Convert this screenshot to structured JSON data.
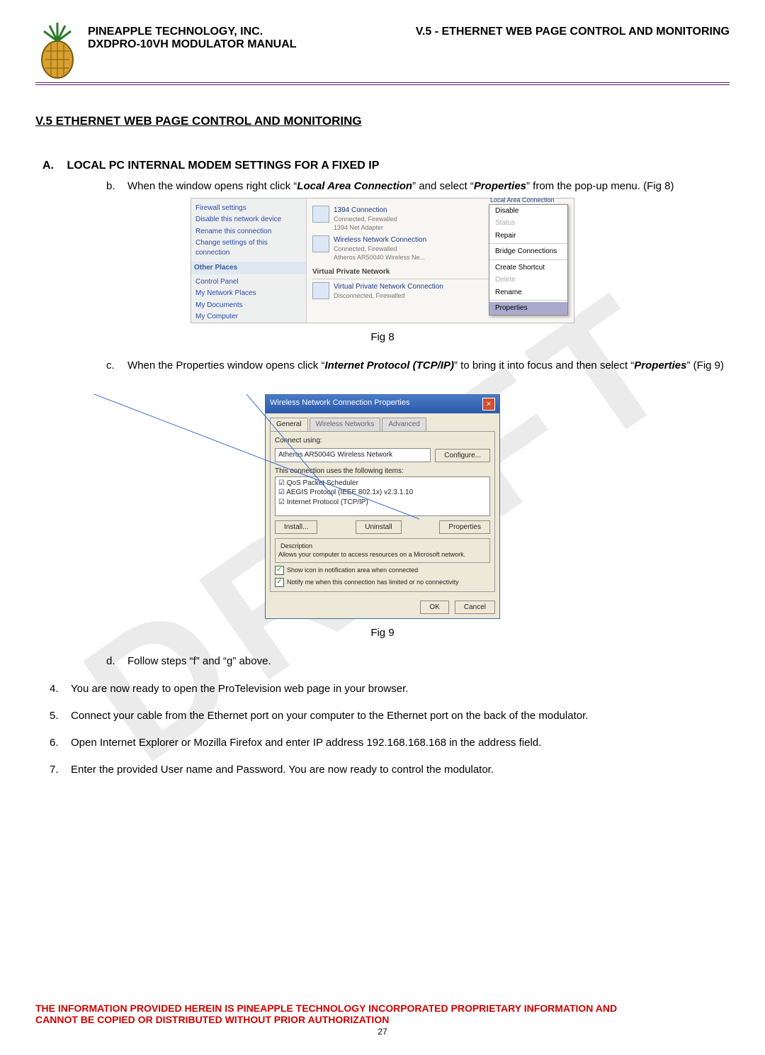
{
  "header": {
    "company": "PINEAPPLE TECHNOLOGY, INC.",
    "manual": "DXDPRO-10VH MODULATOR MANUAL",
    "section_ref": "V.5 - ETHERNET WEB PAGE CONTROL AND MONITORING"
  },
  "watermark": "DRAFT",
  "section_title": "V.5 ETHERNET WEB PAGE CONTROL AND MONITORING",
  "sub_a": {
    "letter": "A.",
    "title": "LOCAL PC INTERNAL MODEM SETTINGS FOR A FIXED IP"
  },
  "item_b": {
    "marker": "b.",
    "pre": "When the window opens right click “",
    "em1": "Local Area Connection",
    "mid": "” and select “",
    "em2": "Properties",
    "post": "” from the pop-up menu. (Fig 8)"
  },
  "fig8": {
    "caption": "Fig 8",
    "tasks": [
      "Firewall settings",
      "Disable this network device",
      "Rename this connection",
      "Change settings of this connection"
    ],
    "other_header": "Other Places",
    "other": [
      "Control Panel",
      "My Network Places",
      "My Documents",
      "My Computer"
    ],
    "conn1": {
      "title": "1394 Connection",
      "sub": "Connected, Firewalled",
      "sub2": "1394 Net Adapter"
    },
    "conn2": {
      "title": "Wireless Network Connection",
      "sub": "Connected, Firewalled",
      "sub2": "Atheros AR50040 Wireless Ne..."
    },
    "vpn_header": "Virtual Private Network",
    "conn3": {
      "title": "Virtual Private Network Connection",
      "sub": "Disconnected, Firewalled"
    },
    "lac": "Local Area Connection",
    "menu": [
      "Disable",
      "Status",
      "Repair",
      "Bridge Connections",
      "Create Shortcut",
      "Delete",
      "Rename",
      "Properties"
    ]
  },
  "item_c": {
    "marker": "c.",
    "pre": "When the Properties window opens click “",
    "em1": "Internet Protocol (TCP/IP)",
    "mid": "” to bring it into focus and then select “",
    "em2": "Properties",
    "post": "” (Fig 9)"
  },
  "fig9": {
    "caption": "Fig 9",
    "title": "Wireless Network Connection Properties",
    "tabs": [
      "General",
      "Wireless Networks",
      "Advanced"
    ],
    "connect_using_label": "Connect using:",
    "adapter": "Atheros AR5004G Wireless Network",
    "configure": "Configure...",
    "uses_label": "This connection uses the following items:",
    "items": [
      "QoS Packet Scheduler",
      "AEGIS Protocol (IEEE 802.1x) v2.3.1.10",
      "Internet Protocol (TCP/IP)"
    ],
    "install": "Install...",
    "uninstall": "Uninstall",
    "properties": "Properties",
    "desc_label": "Description",
    "desc": "Allows your computer to access resources on a Microsoft network.",
    "chk1": "Show icon in notification area when connected",
    "chk2": "Notify me when this connection has limited or no connectivity",
    "ok": "OK",
    "cancel": "Cancel"
  },
  "item_d": {
    "marker": "d.",
    "text": "Follow steps “f” and “g” above."
  },
  "step4": {
    "marker": "4.",
    "text": "You are now ready to open the ProTelevision web page in your browser."
  },
  "step5": {
    "marker": "5.",
    "text": "Connect your cable from the Ethernet port on your computer to the Ethernet port on the back of the modulator."
  },
  "step6": {
    "marker": "6.",
    "text": "Open Internet Explorer or Mozilla Firefox and enter IP address 192.168.168.168 in the address field."
  },
  "step7": {
    "marker": "7.",
    "text": "Enter the provided User name and Password.  You are now ready to control the modulator."
  },
  "footer": {
    "line1": "THE INFORMATION PROVIDED HEREIN IS PINEAPPLE TECHNOLOGY INCORPORATED PROPRIETARY INFORMATION AND",
    "line2": "CANNOT BE COPIED OR DISTRIBUTED WITHOUT PRIOR AUTHORIZATION",
    "page": "27"
  }
}
